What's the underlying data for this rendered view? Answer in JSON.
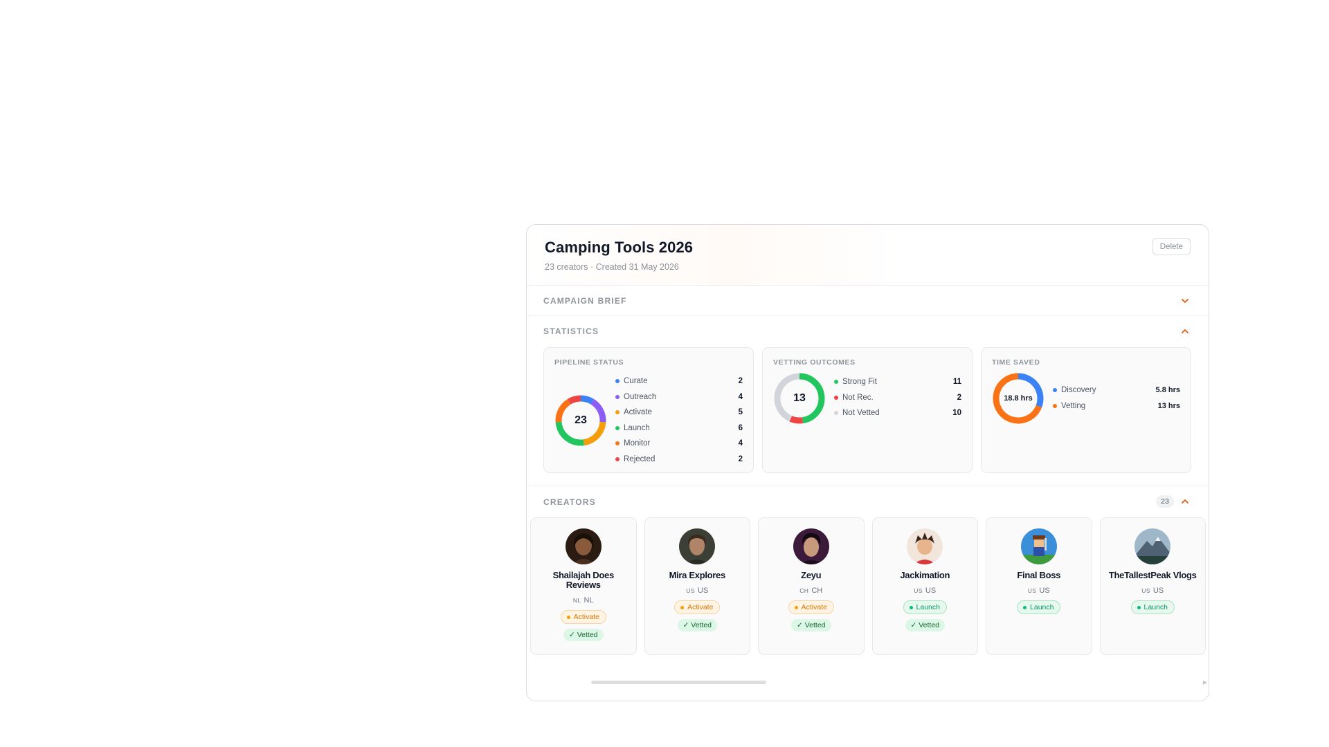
{
  "campaign": {
    "title": "Camping Tools 2026",
    "subtitle": "23 creators · Created 31 May 2026",
    "delete_label": "Delete"
  },
  "sections": {
    "brief": "CAMPAIGN BRIEF",
    "statistics": "STATISTICS",
    "creators": "CREATORS",
    "creators_count": "23"
  },
  "stats": {
    "pipeline": {
      "title": "PIPELINE STATUS",
      "total": "23",
      "items": [
        {
          "label": "Curate",
          "value": "2",
          "color": "#3b82f6"
        },
        {
          "label": "Outreach",
          "value": "4",
          "color": "#8b5cf6"
        },
        {
          "label": "Activate",
          "value": "5",
          "color": "#f59e0b"
        },
        {
          "label": "Launch",
          "value": "6",
          "color": "#22c55e"
        },
        {
          "label": "Monitor",
          "value": "4",
          "color": "#f97316"
        },
        {
          "label": "Rejected",
          "value": "2",
          "color": "#ef4444"
        }
      ]
    },
    "vetting": {
      "title": "VETTING OUTCOMES",
      "total": "13",
      "items": [
        {
          "label": "Strong Fit",
          "value": "11",
          "color": "#22c55e"
        },
        {
          "label": "Not Rec.",
          "value": "2",
          "color": "#ef4444"
        },
        {
          "label": "Not Vetted",
          "value": "10",
          "color": "#d1d5db"
        }
      ]
    },
    "time": {
      "title": "TIME SAVED",
      "total": "18.8 hrs",
      "items": [
        {
          "label": "Discovery",
          "value": "5.8 hrs",
          "amount": 5.8,
          "color": "#3b82f6"
        },
        {
          "label": "Vetting",
          "value": "13 hrs",
          "amount": 13,
          "color": "#f97316"
        }
      ]
    }
  },
  "creators": [
    {
      "name": "Shailajah Does Reviews",
      "cc": "NL",
      "country": "NL",
      "stage": "Activate",
      "vetted": "✓ Vetted",
      "avatar": "avatar-portrait-woman"
    },
    {
      "name": "Mira Explores",
      "cc": "US",
      "country": "US",
      "stage": "Activate",
      "vetted": "✓ Vetted",
      "avatar": "avatar-portrait-man"
    },
    {
      "name": "Zeyu",
      "cc": "CH",
      "country": "CH",
      "stage": "Activate",
      "vetted": "✓ Vetted",
      "avatar": "avatar-portrait-young"
    },
    {
      "name": "Jackimation",
      "cc": "US",
      "country": "US",
      "stage": "Launch",
      "vetted": "✓ Vetted",
      "avatar": "avatar-cartoon"
    },
    {
      "name": "Final Boss",
      "cc": "US",
      "country": "US",
      "stage": "Launch",
      "vetted": "",
      "avatar": "avatar-pixel-hero"
    },
    {
      "name": "TheTallestPeak Vlogs",
      "cc": "US",
      "country": "US",
      "stage": "Launch",
      "vetted": "",
      "avatar": "avatar-mountain"
    }
  ]
}
